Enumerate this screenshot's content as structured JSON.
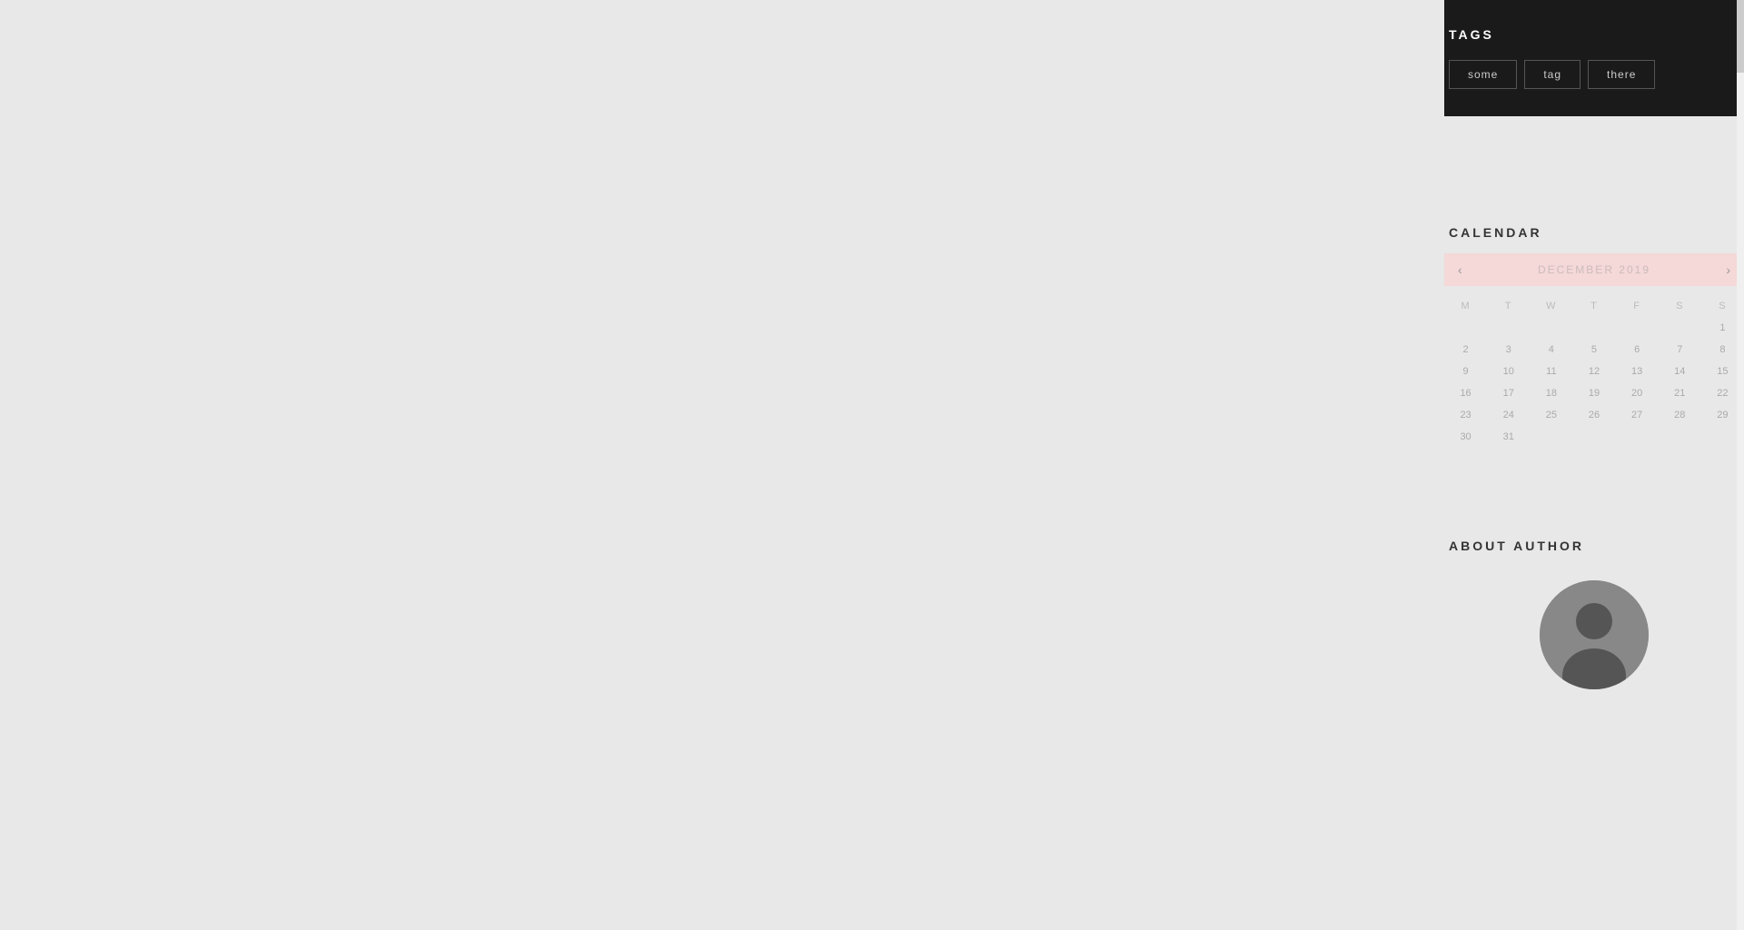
{
  "main": {
    "background_color": "#e8e8e8"
  },
  "sidebar": {
    "tags_widget": {
      "title": "TAGS",
      "tags": [
        {
          "label": "some"
        },
        {
          "label": "tag"
        },
        {
          "label": "there"
        }
      ]
    },
    "calendar_widget": {
      "title": "CALENDAR",
      "month_label": "December 2019",
      "prev_btn": "‹",
      "next_btn": "›",
      "weekdays": [
        "M",
        "T",
        "W",
        "T",
        "F",
        "S",
        "S"
      ],
      "weeks": [
        [
          "",
          "",
          "",
          "",
          "",
          "",
          "1"
        ],
        [
          "2",
          "3",
          "4",
          "5",
          "6",
          "7",
          "8"
        ],
        [
          "9",
          "10",
          "11",
          "12",
          "13",
          "14",
          "15"
        ],
        [
          "16",
          "17",
          "18",
          "19",
          "20",
          "21",
          "22"
        ],
        [
          "23",
          "24",
          "25",
          "26",
          "27",
          "28",
          "29"
        ],
        [
          "30",
          "31",
          "",
          "",
          "",
          "",
          ""
        ]
      ]
    },
    "about_author_widget": {
      "title": "ABOUT AUTHOR"
    }
  },
  "scrollbar": {
    "thumb_top": 0,
    "thumb_height": 80
  }
}
